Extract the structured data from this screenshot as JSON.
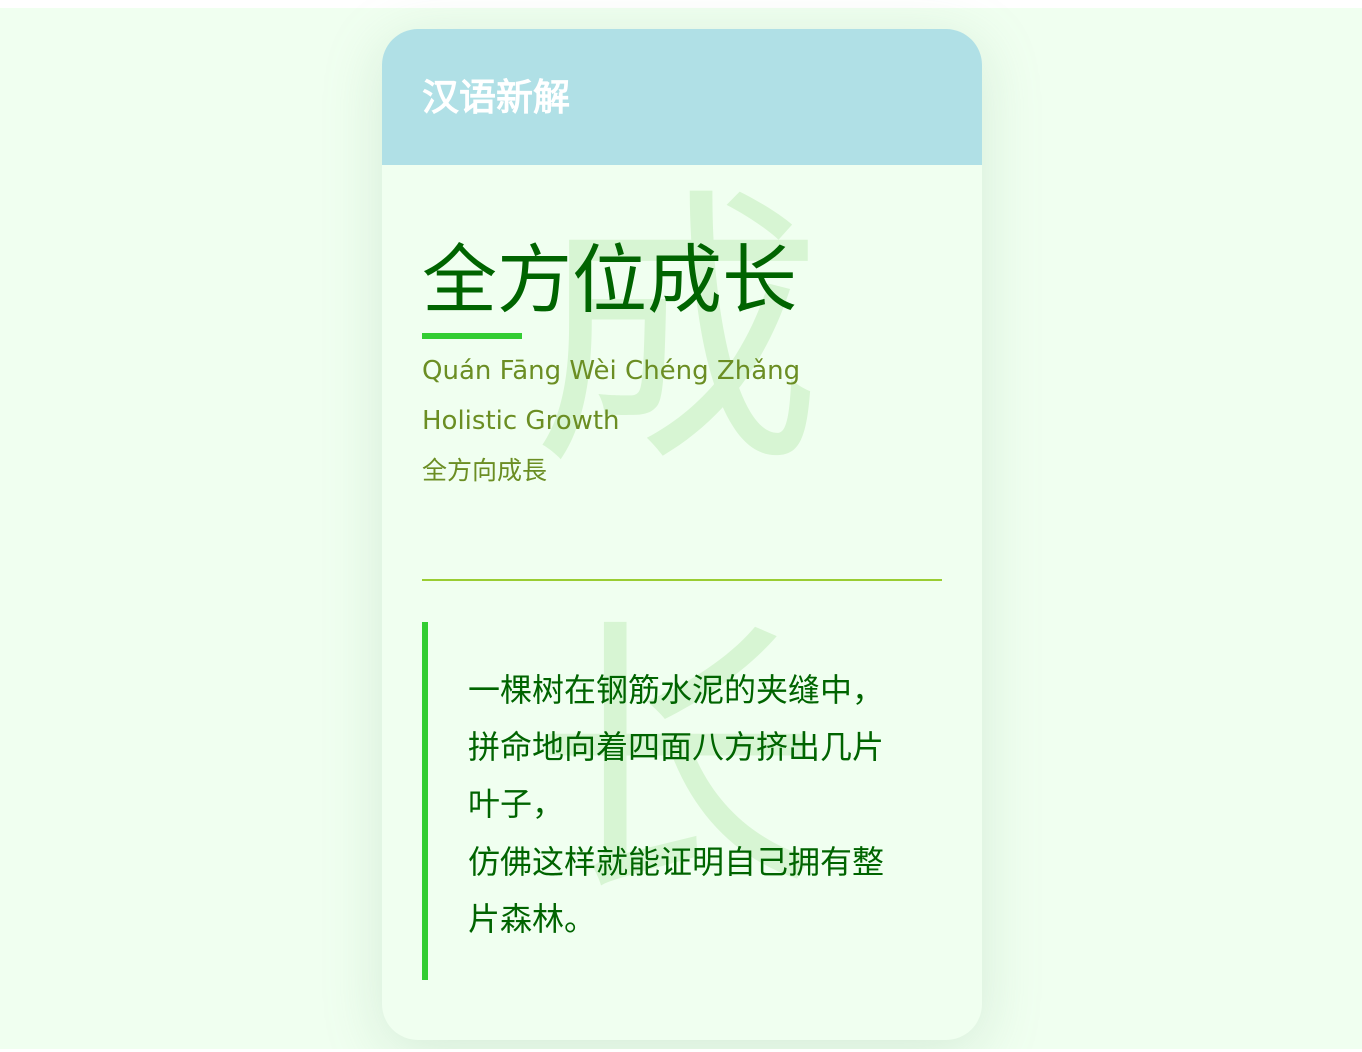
{
  "header": {
    "title": "汉语新解"
  },
  "watermark": {
    "char_1": "成",
    "char_2": "长"
  },
  "word": {
    "chinese": "全方位成长",
    "pinyin": "Quán Fāng Wèi Chéng Zhǎng",
    "english": "Holistic Growth",
    "traditional": "全方向成長"
  },
  "quote": {
    "lines": [
      "一棵树在钢筋水泥的夹缝中，",
      "拼命地向着四面八方挤出几片",
      "叶子，",
      "仿佛这样就能证明自己拥有整",
      "片森林。"
    ]
  },
  "colors": {
    "page_background": "#f0fff0",
    "header_background": "#b0e0e6",
    "title_green": "#006400",
    "accent_green": "#32cd32",
    "olive_text": "#6b8e23",
    "divider": "#9acd32",
    "watermark": "#c8efc0"
  }
}
